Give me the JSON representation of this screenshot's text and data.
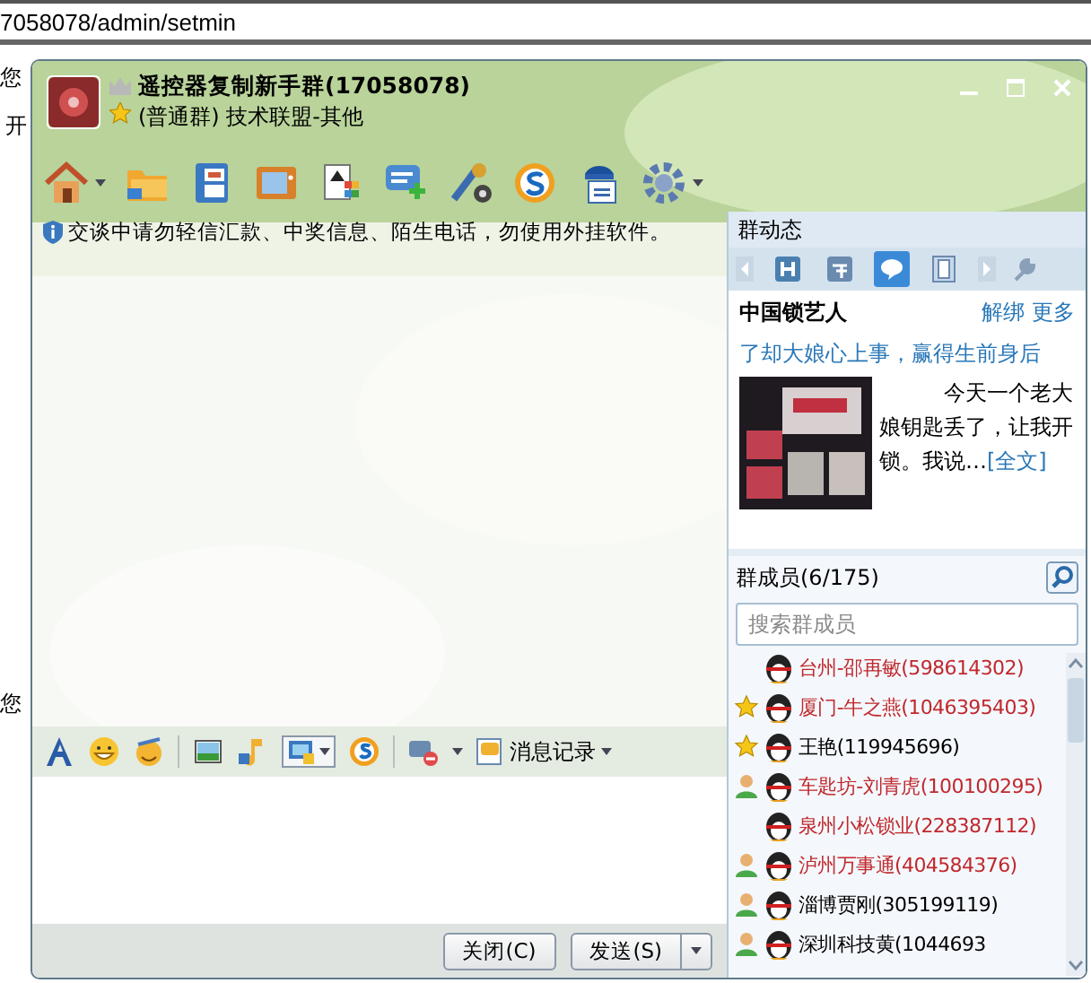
{
  "browser": {
    "address": "7058078/admin/setmin",
    "page_texts": [
      "您",
      "开",
      "您"
    ]
  },
  "window": {
    "group_name": "遥控器复制新手群(17058078)",
    "group_info": "(普通群) 技术联盟-其他"
  },
  "toolbar": [
    {
      "kind": "home",
      "dropdown": true
    },
    {
      "kind": "folder",
      "dropdown": false
    },
    {
      "kind": "book",
      "dropdown": false
    },
    {
      "kind": "screen",
      "dropdown": false
    },
    {
      "kind": "cards",
      "dropdown": false
    },
    {
      "kind": "chatplus",
      "dropdown": false
    },
    {
      "kind": "tools",
      "dropdown": false
    },
    {
      "kind": "slogo",
      "dropdown": false
    },
    {
      "kind": "card",
      "dropdown": false
    },
    {
      "kind": "gear",
      "dropdown": true
    }
  ],
  "notice": "交谈中请勿轻信汇款、中奖信息、陌生电话，勿使用外挂软件。",
  "format_toolbar": {
    "history_label": "消息记录"
  },
  "buttons": {
    "close": "关闭(C)",
    "send": "发送(S)"
  },
  "side_panel": {
    "title": "群动态",
    "tabs": [
      {
        "kind": "h",
        "selected": false
      },
      {
        "kind": "calendar",
        "selected": false
      },
      {
        "kind": "bubble",
        "selected": true
      },
      {
        "kind": "film",
        "selected": false
      }
    ],
    "feed": {
      "source": "中国锁艺人",
      "links": [
        "解绑",
        "更多"
      ],
      "headline": "了却大娘心上事，赢得生前身后",
      "excerpt": "今天一个老大娘钥匙丢了，让我开锁。我说…",
      "more": "[全文]"
    }
  },
  "members": {
    "title": "群成员(6/175)",
    "placeholder": "搜索群成员",
    "items": [
      {
        "name": "台州-邵再敏(598614302)",
        "kind": "plain",
        "color": "#c0282d"
      },
      {
        "name": "厦门-牛之燕(1046395403)",
        "kind": "admin",
        "color": "#c0282d"
      },
      {
        "name": "王艳(119945696)",
        "kind": "admin",
        "color": "#000000"
      },
      {
        "name": "车匙坊-刘青虎(100100295)",
        "kind": "member",
        "color": "#c0282d"
      },
      {
        "name": "泉州小松锁业(228387112)",
        "kind": "plain",
        "color": "#c0282d"
      },
      {
        "name": "泸州万事通(404584376)",
        "kind": "member",
        "color": "#c0282d"
      },
      {
        "name": "淄博贾刚(305199119)",
        "kind": "member",
        "color": "#000000"
      },
      {
        "name": "深圳科技黄(1044693",
        "kind": "member",
        "color": "#000000"
      }
    ]
  }
}
